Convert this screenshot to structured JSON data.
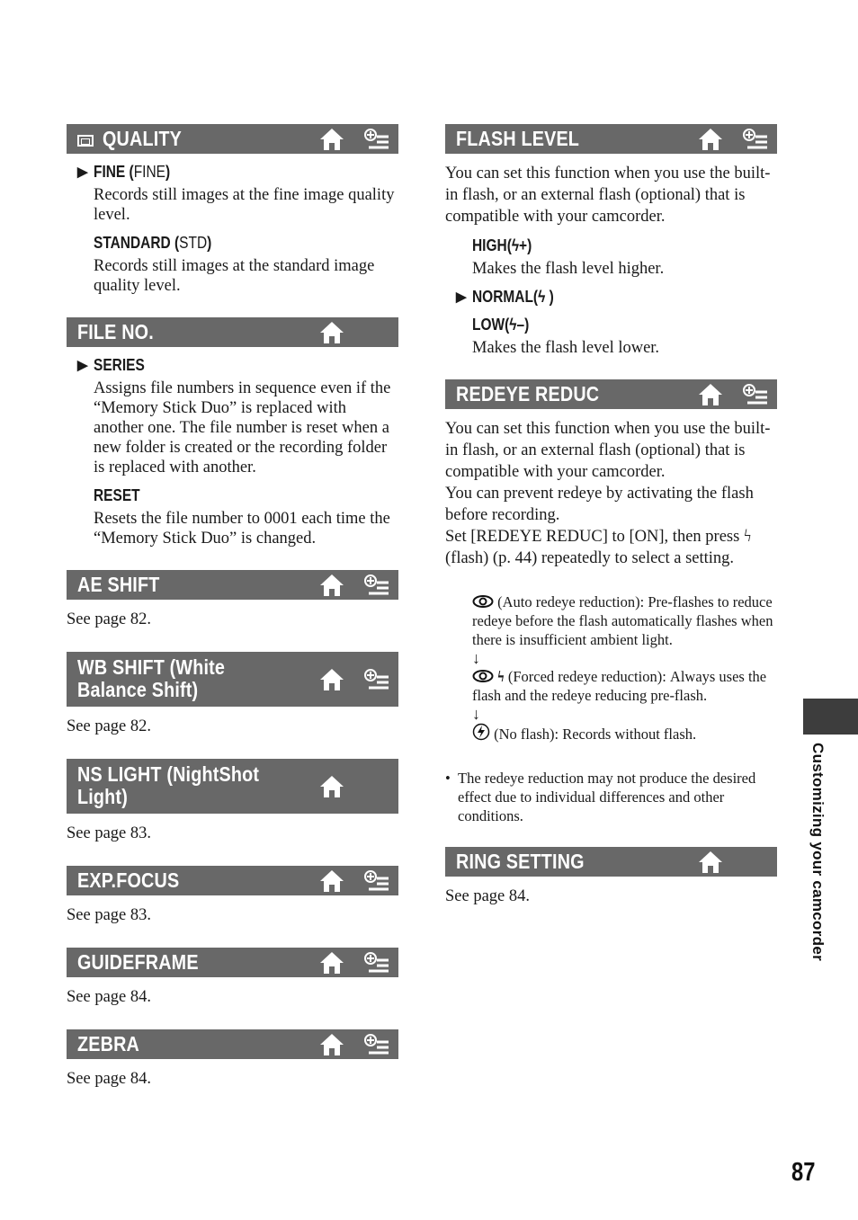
{
  "page_number": "87",
  "side_tab_label": "Customizing your camcorder",
  "header_color": "#686868",
  "left_column": {
    "quality": {
      "title": "QUALITY",
      "icons": [
        "quality-mode-icon",
        "home-icon",
        "personal-menu-icon"
      ],
      "options": [
        {
          "label": "FINE (",
          "symbol": "FINE",
          "close": ")",
          "default": true,
          "description": "Records still images at the fine image quality level."
        },
        {
          "label": "STANDARD (",
          "symbol": "STD",
          "close": ")",
          "default": false,
          "description": "Records still images at the standard image quality level."
        }
      ]
    },
    "file_no": {
      "title": "FILE NO.",
      "icons": [
        "home-icon"
      ],
      "options": [
        {
          "label": "SERIES",
          "default": true,
          "description": "Assigns file numbers in sequence even if the “Memory Stick Duo” is replaced with another one. The file number is reset when a new folder is created or the recording folder is replaced with another."
        },
        {
          "label": "RESET",
          "default": false,
          "description": "Resets the file number to 0001 each time the “Memory Stick Duo” is changed."
        }
      ]
    },
    "ae_shift": {
      "title": "AE SHIFT",
      "see": "See page 82."
    },
    "wb_shift": {
      "title_line1": "WB SHIFT (White",
      "title_line2": "Balance Shift)",
      "see": "See page 82."
    },
    "ns_light": {
      "title_line1": "NS LIGHT (NightShot",
      "title_line2": "Light)",
      "see": "See page 83."
    },
    "exp_focus": {
      "title": "EXP.FOCUS",
      "see": "See page 83."
    },
    "guideframe": {
      "title": "GUIDEFRAME",
      "see": "See page 84."
    },
    "zebra": {
      "title": "ZEBRA",
      "see": "See page 84."
    }
  },
  "right_column": {
    "flash_level": {
      "title": "FLASH LEVEL",
      "intro": "You can set this function when you use the built-in flash, or an external flash (optional) that is compatible with your camcorder.",
      "options": [
        {
          "label": "HIGH(ϟ+)",
          "default": false,
          "description": "Makes the flash level higher."
        },
        {
          "label": "NORMAL(ϟ )",
          "default": true,
          "description": ""
        },
        {
          "label": "LOW(ϟ–)",
          "default": false,
          "description": "Makes the flash level lower."
        }
      ]
    },
    "redeye_reduc": {
      "title": "REDEYE REDUC",
      "intro_1": "You can set this function when you use the built-in flash, or an external flash (optional) that is compatible with your camcorder.",
      "intro_2": "You can prevent redeye by activating the flash before recording.",
      "intro_3a": "Set [REDEYE REDUC] to [ON], then press",
      "intro_3b": "(flash) (p. 44) repeatedly to select a setting.",
      "modes": [
        {
          "icon": "redeye-icon",
          "text": "(Auto redeye reduction): Pre-flashes to reduce redeye before the flash automatically flashes when there is insufficient ambient light."
        },
        {
          "icon": "redeye-flash-icon",
          "text": "(Forced redeye reduction): Always uses the flash and the redeye reducing pre-flash."
        },
        {
          "icon": "no-flash-icon",
          "text": "(No flash): Records without flash."
        }
      ],
      "arrow": "↓",
      "note_bullet": "•",
      "note": "The redeye reduction may not produce the desired effect due to individual differences and other conditions."
    },
    "ring_setting": {
      "title": "RING SETTING",
      "see": "See page 84."
    }
  },
  "glyphs": {
    "default_marker": "▶",
    "flash": "ϟ"
  }
}
